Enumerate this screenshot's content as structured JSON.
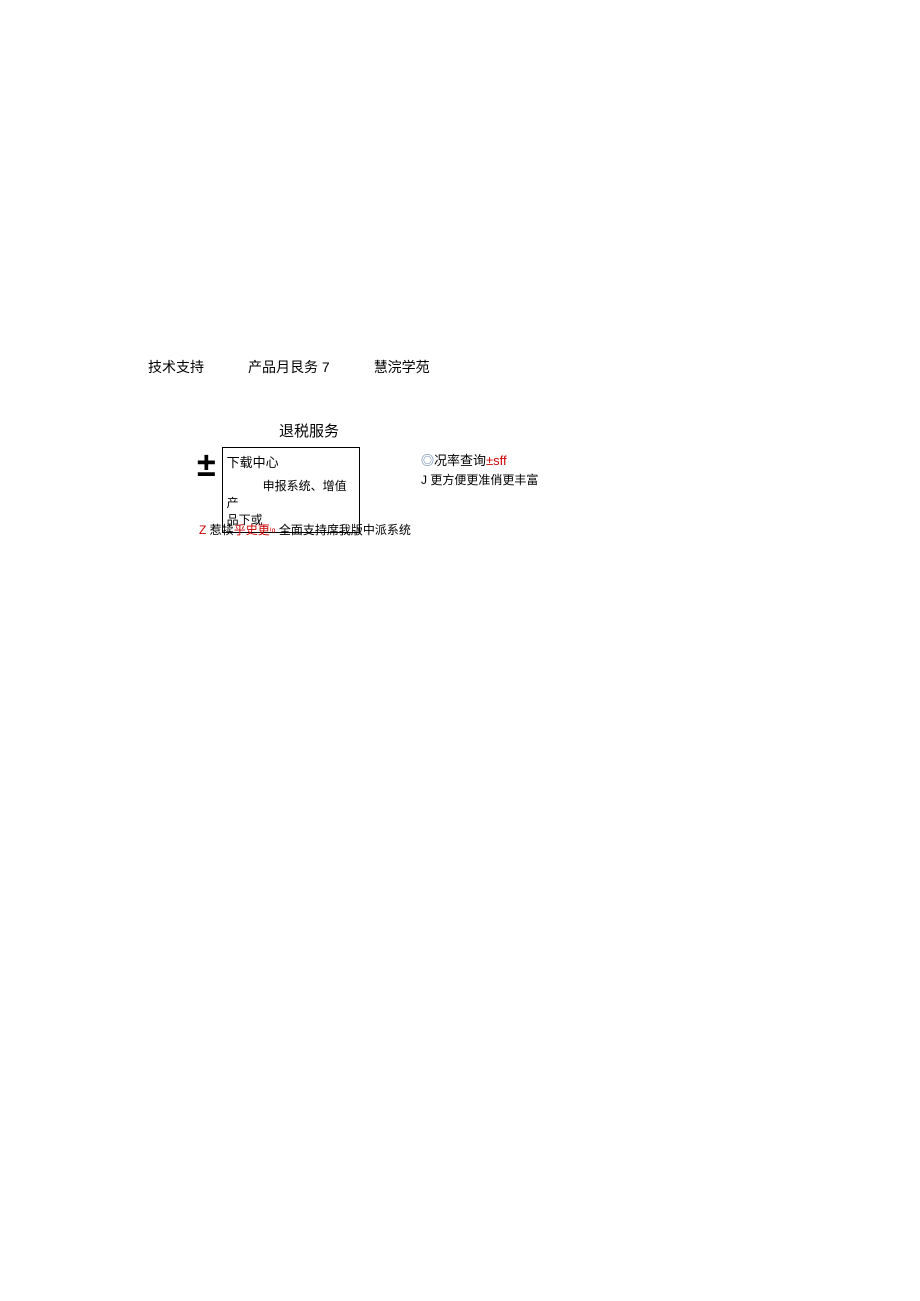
{
  "nav": {
    "item1": "技术支持",
    "item2": "产品月艮务 7",
    "item3": "慧浣学苑"
  },
  "section_title": "退税服务",
  "download": {
    "icon": "±",
    "title": "下载中心",
    "line2": "申报系统、增值产",
    "line3": "品下或"
  },
  "rate": {
    "circle": "◎",
    "query": "况率查询",
    "suffix": "±sff",
    "sub": "J 更方便更准俏更丰富"
  },
  "bottom": {
    "z": "Z",
    "part1": " 惹犊",
    "red1": "乎史更",
    "tiny": "!ɑ",
    "part2": " 全面支持席我版中派系统"
  }
}
